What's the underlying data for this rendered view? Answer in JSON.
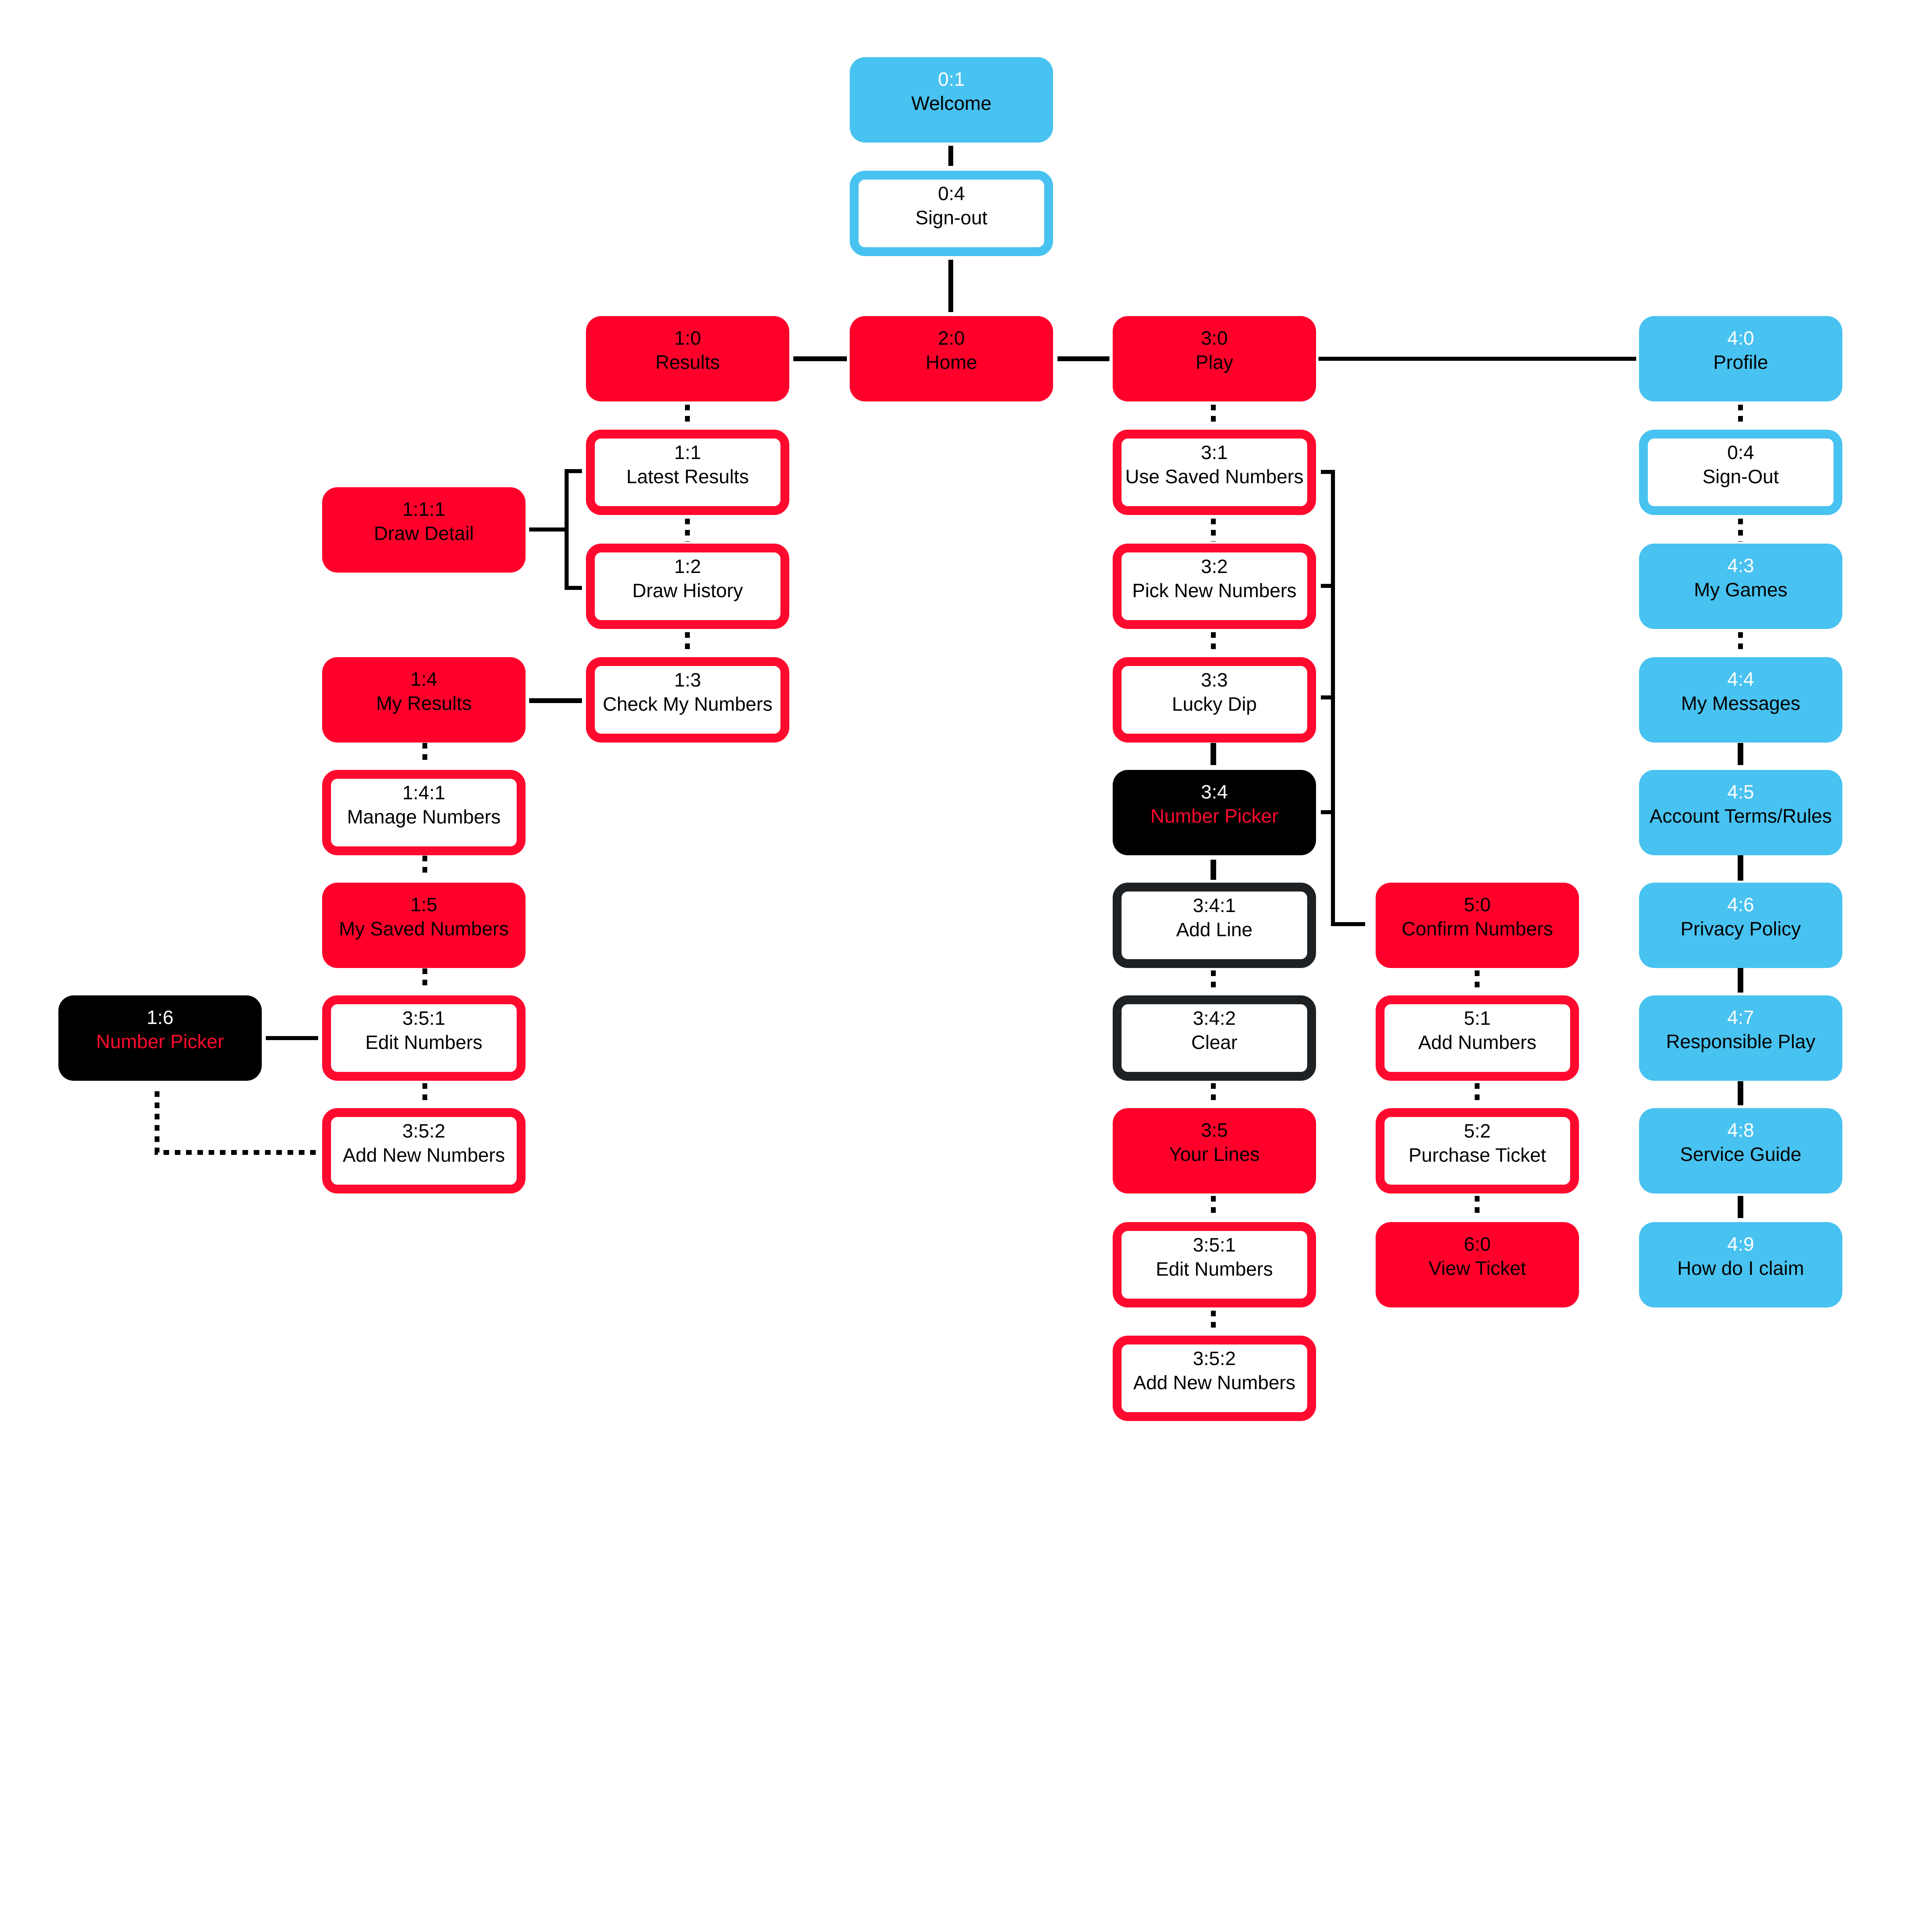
{
  "diagram": {
    "type": "sitemap",
    "colors": {
      "primary_red": "#ff002b",
      "profile_blue": "#48c2f0",
      "picker_black": "#000000",
      "outline_dark": "#1e2124",
      "connector": "#000000"
    },
    "nodes": {
      "welcome": {
        "code": "0:1",
        "label": "Welcome"
      },
      "signout_top": {
        "code": "0:4",
        "label": "Sign-out"
      },
      "results": {
        "code": "1:0",
        "label": "Results"
      },
      "home": {
        "code": "2:0",
        "label": "Home"
      },
      "play": {
        "code": "3:0",
        "label": "Play"
      },
      "profile": {
        "code": "4:0",
        "label": "Profile"
      },
      "latest_results": {
        "code": "1:1",
        "label": "Latest Results"
      },
      "draw_history": {
        "code": "1:2",
        "label": "Draw History"
      },
      "check_my_numbers": {
        "code": "1:3",
        "label": "Check My Numbers"
      },
      "draw_detail": {
        "code": "1:1:1",
        "label": "Draw Detail"
      },
      "my_results": {
        "code": "1:4",
        "label": "My Results"
      },
      "manage_numbers": {
        "code": "1:4:1",
        "label": "Manage Numbers"
      },
      "my_saved_numbers": {
        "code": "1:5",
        "label": "My Saved Numbers"
      },
      "left_edit_numbers": {
        "code": "3:5:1",
        "label": "Edit Numbers"
      },
      "left_add_new": {
        "code": "3:5:2",
        "label": "Add New Numbers"
      },
      "left_number_picker": {
        "code": "1:6",
        "label": "Number Picker"
      },
      "use_saved_numbers": {
        "code": "3:1",
        "label": "Use Saved Numbers"
      },
      "pick_new_numbers": {
        "code": "3:2",
        "label": "Pick New Numbers"
      },
      "lucky_dip": {
        "code": "3:3",
        "label": "Lucky Dip"
      },
      "number_picker": {
        "code": "3:4",
        "label": "Number Picker"
      },
      "add_line": {
        "code": "3:4:1",
        "label": "Add Line"
      },
      "clear": {
        "code": "3:4:2",
        "label": "Clear"
      },
      "your_lines": {
        "code": "3:5",
        "label": "Your Lines"
      },
      "edit_numbers": {
        "code": "3:5:1",
        "label": "Edit Numbers"
      },
      "add_new_numbers": {
        "code": "3:5:2",
        "label": "Add New Numbers"
      },
      "confirm_numbers": {
        "code": "5:0",
        "label": "Confirm Numbers"
      },
      "add_numbers": {
        "code": "5:1",
        "label": "Add Numbers"
      },
      "purchase_ticket": {
        "code": "5:2",
        "label": "Purchase Ticket"
      },
      "view_ticket": {
        "code": "6:0",
        "label": "View Ticket"
      },
      "signout_profile": {
        "code": "0:4",
        "label": "Sign-Out"
      },
      "my_games": {
        "code": "4:3",
        "label": "My Games"
      },
      "my_messages": {
        "code": "4:4",
        "label": "My Messages"
      },
      "account_terms": {
        "code": "4:5",
        "label": "Account Terms/Rules"
      },
      "privacy_policy": {
        "code": "4:6",
        "label": "Privacy Policy"
      },
      "responsible_play": {
        "code": "4:7",
        "label": "Responsible Play"
      },
      "service_guide": {
        "code": "4:8",
        "label": "Service Guide"
      },
      "how_do_i_claim": {
        "code": "4:9",
        "label": "How do I claim"
      }
    }
  }
}
